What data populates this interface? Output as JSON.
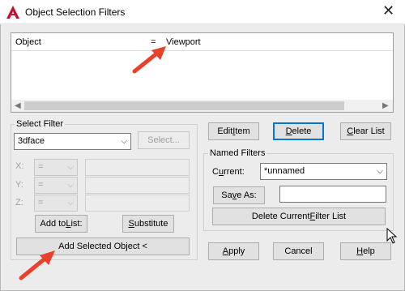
{
  "window": {
    "title": "Object Selection Filters",
    "close_glyph": "✕",
    "logo_letter": "A",
    "logo_color": "#c8102e"
  },
  "filter_list": {
    "col_object": "Object",
    "col_eq": "=",
    "col_value": "Viewport"
  },
  "select_filter": {
    "group_label": "Select Filter",
    "type_value": "3dface",
    "select_button": "Select...",
    "x_label": "X:",
    "y_label": "Y:",
    "z_label": "Z:",
    "x_op": "=",
    "y_op": "=",
    "z_op": "=",
    "add_to_list_pre": "Add to ",
    "add_to_list_u": "L",
    "add_to_list_post": "ist:",
    "substitute_pre": "",
    "substitute_u": "S",
    "substitute_post": "ubstitute",
    "add_selected": "Add Selected Object <"
  },
  "list_actions": {
    "edit_item_pre": "Edit ",
    "edit_item_u": "I",
    "edit_item_post": "tem",
    "delete_pre": "",
    "delete_u": "D",
    "delete_post": "elete",
    "clear_list_pre": "",
    "clear_list_u": "C",
    "clear_list_post": "lear List"
  },
  "named_filters": {
    "group_label": "Named Filters",
    "current_label_pre": "C",
    "current_label_u": "u",
    "current_label_post": "rrent:",
    "current_value": "*unnamed",
    "save_as_pre": "Sa",
    "save_as_u": "v",
    "save_as_post": "e As:",
    "save_as_value": "",
    "delete_current_pre": "Delete Current ",
    "delete_current_u": "F",
    "delete_current_post": "ilter List"
  },
  "footer": {
    "apply_pre": "",
    "apply_u": "A",
    "apply_post": "pply",
    "cancel": "Cancel",
    "help_pre": "",
    "help_u": "H",
    "help_post": "elp"
  },
  "colors": {
    "arrow": "#e8412c",
    "focus": "#0078d7"
  }
}
